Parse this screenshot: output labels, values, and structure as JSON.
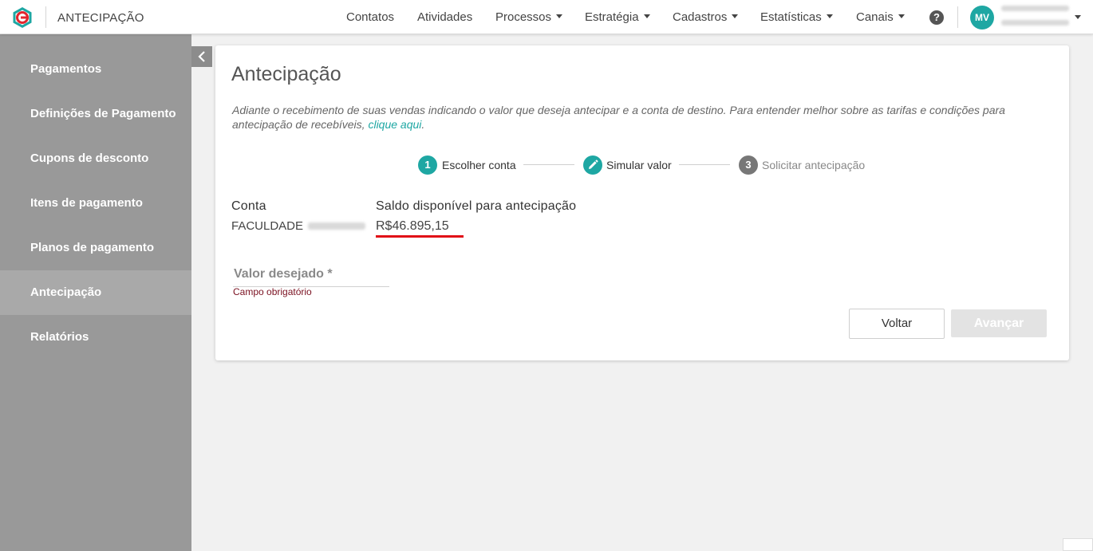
{
  "header": {
    "app_title": "ANTECIPAÇÃO",
    "nav": [
      {
        "label": "Contatos"
      },
      {
        "label": "Atividades"
      },
      {
        "label": "Processos"
      },
      {
        "label": "Estratégia"
      },
      {
        "label": "Cadastros"
      },
      {
        "label": "Estatísticas"
      },
      {
        "label": "Canais"
      }
    ],
    "help_glyph": "?",
    "avatar_initials": "MV",
    "brand_color": "#1ea7a3",
    "logo_color": "#e3262e"
  },
  "sidebar": {
    "items": [
      {
        "label": "Pagamentos"
      },
      {
        "label": "Definições de Pagamento"
      },
      {
        "label": "Cupons de desconto"
      },
      {
        "label": "Itens de pagamento"
      },
      {
        "label": "Planos de pagamento"
      },
      {
        "label": "Antecipação"
      },
      {
        "label": "Relatórios"
      }
    ],
    "active_item": "Antecipação"
  },
  "main": {
    "title": "Antecipação",
    "description": "Adiante o recebimento de suas vendas indicando o valor que deseja antecipar e a conta de destino. Para entender melhor sobre as tarifas e condições para antecipação de recebíveis, ",
    "description_link": "clique aqui",
    "description_end": ".",
    "steps": [
      {
        "number": "1",
        "label": "Escolher conta",
        "state": "done",
        "icon": "number-badge"
      },
      {
        "number": "",
        "label": "Simular valor",
        "state": "current",
        "icon": "pencil-icon"
      },
      {
        "number": "3",
        "label": "Solicitar antecipação",
        "state": "pending",
        "icon": "number-badge"
      }
    ],
    "account": {
      "label": "Conta",
      "value": "FACULDADE"
    },
    "balance": {
      "label": "Saldo disponível para antecipação",
      "value": "R$46.895,15"
    },
    "amount_field": {
      "label": "Valor desejado *",
      "error": "Campo obrigatório"
    },
    "buttons": {
      "back": "Voltar",
      "next": "Avançar"
    }
  }
}
